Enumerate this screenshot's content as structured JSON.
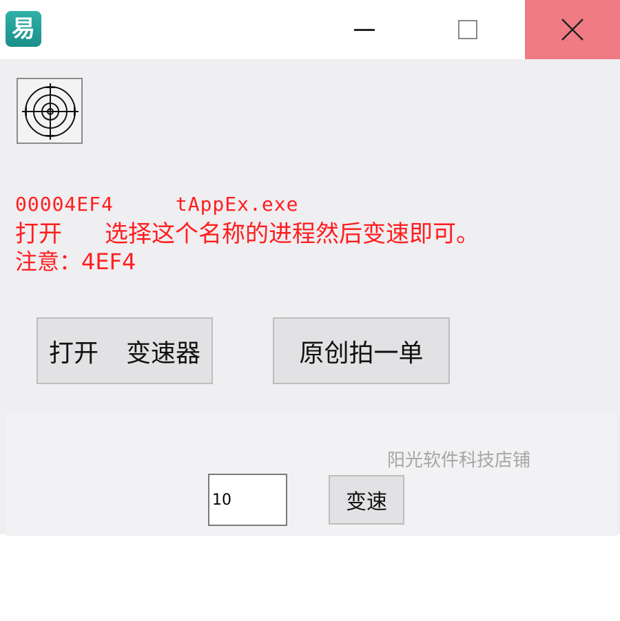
{
  "window": {
    "icon_glyph": "易",
    "minimize_icon": "minimize-icon",
    "maximize_icon": "maximize-icon",
    "close_icon": "close-icon"
  },
  "target_tool": {
    "icon": "crosshair-target-icon"
  },
  "info": {
    "pid": "00004EF4",
    "process_name": "tAppEx.exe",
    "instruction_prefix": "打开",
    "instruction_text": "选择这个名称的进程然后变速即可。",
    "note": "注意：4EF4"
  },
  "buttons": {
    "open_label_a": "打开",
    "open_label_b": "变速器",
    "original_label": "原创拍一单",
    "speed_label": "变速"
  },
  "speed_input": {
    "value": "10"
  },
  "watermark": "阳光软件科技店铺",
  "colors": {
    "highlight_text": "#ff1e1e",
    "close_button": "#f07b84"
  }
}
